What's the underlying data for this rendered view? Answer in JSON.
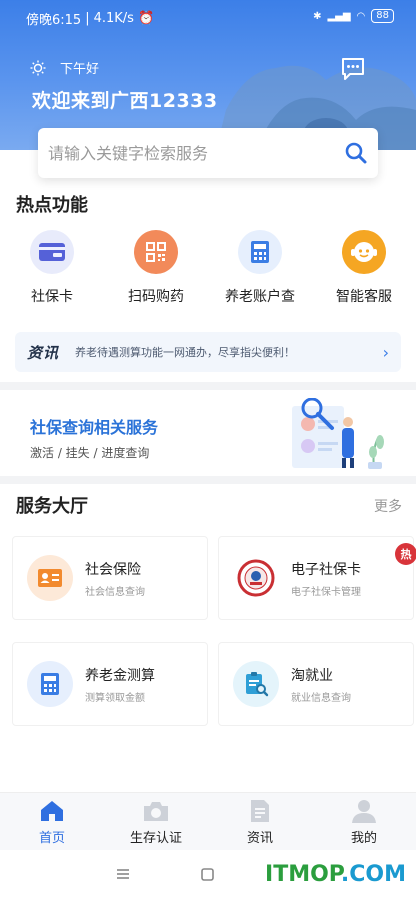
{
  "status": {
    "time": "傍晚6:15",
    "speed": "4.1K/s",
    "battery": "88"
  },
  "header": {
    "greeting": "下午好",
    "welcome": "欢迎来到广西12333"
  },
  "search": {
    "placeholder": "请输入关键字检索服务"
  },
  "hot": {
    "title": "热点功能",
    "items": [
      {
        "label": "社保卡",
        "icon": "card-icon"
      },
      {
        "label": "扫码购药",
        "icon": "qrcode-icon"
      },
      {
        "label": "养老账户查",
        "icon": "calculator-icon"
      },
      {
        "label": "智能客服",
        "icon": "robot-icon"
      }
    ]
  },
  "news": {
    "tag": "资讯",
    "text": "养老待遇测算功能一网通办，尽享指尖便利！"
  },
  "banner": {
    "title": "社保查询相关服务",
    "subtitle": "激活 / 挂失 / 进度查询"
  },
  "services": {
    "title": "服务大厅",
    "more": "更多",
    "hot_badge": "热",
    "cards": [
      {
        "title": "社会保险",
        "subtitle": "社会信息查询"
      },
      {
        "title": "电子社保卡",
        "subtitle": "电子社保卡管理"
      },
      {
        "title": "养老金测算",
        "subtitle": "测算领取金额"
      },
      {
        "title": "淘就业",
        "subtitle": "就业信息查询"
      }
    ]
  },
  "tabs": [
    {
      "label": "首页"
    },
    {
      "label": "生存认证"
    },
    {
      "label": "资讯"
    },
    {
      "label": "我的"
    }
  ],
  "watermark": {
    "left": "ITMOP",
    "right": ".COM"
  },
  "colors": {
    "primary": "#2f6fe0",
    "header": "#3c7fe8",
    "hot_badge": "#d8343a",
    "orange": "#f28a2e"
  }
}
